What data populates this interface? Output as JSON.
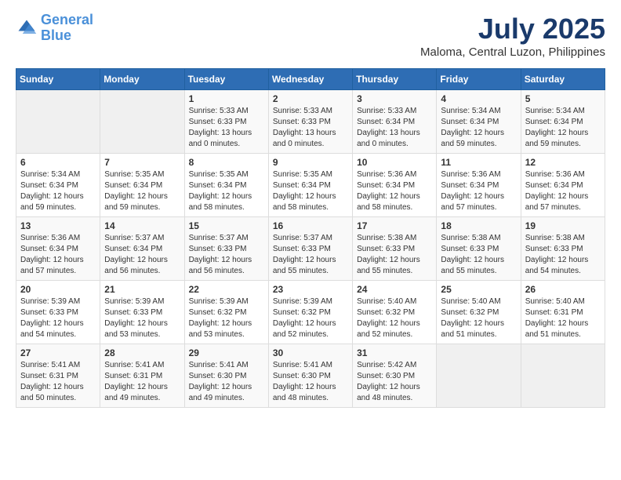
{
  "logo": {
    "line1": "General",
    "line2": "Blue"
  },
  "title": "July 2025",
  "location": "Maloma, Central Luzon, Philippines",
  "weekdays": [
    "Sunday",
    "Monday",
    "Tuesday",
    "Wednesday",
    "Thursday",
    "Friday",
    "Saturday"
  ],
  "weeks": [
    [
      {
        "day": "",
        "sunrise": "",
        "sunset": "",
        "daylight": ""
      },
      {
        "day": "",
        "sunrise": "",
        "sunset": "",
        "daylight": ""
      },
      {
        "day": "1",
        "sunrise": "Sunrise: 5:33 AM",
        "sunset": "Sunset: 6:33 PM",
        "daylight": "Daylight: 13 hours and 0 minutes."
      },
      {
        "day": "2",
        "sunrise": "Sunrise: 5:33 AM",
        "sunset": "Sunset: 6:33 PM",
        "daylight": "Daylight: 13 hours and 0 minutes."
      },
      {
        "day": "3",
        "sunrise": "Sunrise: 5:33 AM",
        "sunset": "Sunset: 6:34 PM",
        "daylight": "Daylight: 13 hours and 0 minutes."
      },
      {
        "day": "4",
        "sunrise": "Sunrise: 5:34 AM",
        "sunset": "Sunset: 6:34 PM",
        "daylight": "Daylight: 12 hours and 59 minutes."
      },
      {
        "day": "5",
        "sunrise": "Sunrise: 5:34 AM",
        "sunset": "Sunset: 6:34 PM",
        "daylight": "Daylight: 12 hours and 59 minutes."
      }
    ],
    [
      {
        "day": "6",
        "sunrise": "Sunrise: 5:34 AM",
        "sunset": "Sunset: 6:34 PM",
        "daylight": "Daylight: 12 hours and 59 minutes."
      },
      {
        "day": "7",
        "sunrise": "Sunrise: 5:35 AM",
        "sunset": "Sunset: 6:34 PM",
        "daylight": "Daylight: 12 hours and 59 minutes."
      },
      {
        "day": "8",
        "sunrise": "Sunrise: 5:35 AM",
        "sunset": "Sunset: 6:34 PM",
        "daylight": "Daylight: 12 hours and 58 minutes."
      },
      {
        "day": "9",
        "sunrise": "Sunrise: 5:35 AM",
        "sunset": "Sunset: 6:34 PM",
        "daylight": "Daylight: 12 hours and 58 minutes."
      },
      {
        "day": "10",
        "sunrise": "Sunrise: 5:36 AM",
        "sunset": "Sunset: 6:34 PM",
        "daylight": "Daylight: 12 hours and 58 minutes."
      },
      {
        "day": "11",
        "sunrise": "Sunrise: 5:36 AM",
        "sunset": "Sunset: 6:34 PM",
        "daylight": "Daylight: 12 hours and 57 minutes."
      },
      {
        "day": "12",
        "sunrise": "Sunrise: 5:36 AM",
        "sunset": "Sunset: 6:34 PM",
        "daylight": "Daylight: 12 hours and 57 minutes."
      }
    ],
    [
      {
        "day": "13",
        "sunrise": "Sunrise: 5:36 AM",
        "sunset": "Sunset: 6:34 PM",
        "daylight": "Daylight: 12 hours and 57 minutes."
      },
      {
        "day": "14",
        "sunrise": "Sunrise: 5:37 AM",
        "sunset": "Sunset: 6:34 PM",
        "daylight": "Daylight: 12 hours and 56 minutes."
      },
      {
        "day": "15",
        "sunrise": "Sunrise: 5:37 AM",
        "sunset": "Sunset: 6:33 PM",
        "daylight": "Daylight: 12 hours and 56 minutes."
      },
      {
        "day": "16",
        "sunrise": "Sunrise: 5:37 AM",
        "sunset": "Sunset: 6:33 PM",
        "daylight": "Daylight: 12 hours and 55 minutes."
      },
      {
        "day": "17",
        "sunrise": "Sunrise: 5:38 AM",
        "sunset": "Sunset: 6:33 PM",
        "daylight": "Daylight: 12 hours and 55 minutes."
      },
      {
        "day": "18",
        "sunrise": "Sunrise: 5:38 AM",
        "sunset": "Sunset: 6:33 PM",
        "daylight": "Daylight: 12 hours and 55 minutes."
      },
      {
        "day": "19",
        "sunrise": "Sunrise: 5:38 AM",
        "sunset": "Sunset: 6:33 PM",
        "daylight": "Daylight: 12 hours and 54 minutes."
      }
    ],
    [
      {
        "day": "20",
        "sunrise": "Sunrise: 5:39 AM",
        "sunset": "Sunset: 6:33 PM",
        "daylight": "Daylight: 12 hours and 54 minutes."
      },
      {
        "day": "21",
        "sunrise": "Sunrise: 5:39 AM",
        "sunset": "Sunset: 6:33 PM",
        "daylight": "Daylight: 12 hours and 53 minutes."
      },
      {
        "day": "22",
        "sunrise": "Sunrise: 5:39 AM",
        "sunset": "Sunset: 6:32 PM",
        "daylight": "Daylight: 12 hours and 53 minutes."
      },
      {
        "day": "23",
        "sunrise": "Sunrise: 5:39 AM",
        "sunset": "Sunset: 6:32 PM",
        "daylight": "Daylight: 12 hours and 52 minutes."
      },
      {
        "day": "24",
        "sunrise": "Sunrise: 5:40 AM",
        "sunset": "Sunset: 6:32 PM",
        "daylight": "Daylight: 12 hours and 52 minutes."
      },
      {
        "day": "25",
        "sunrise": "Sunrise: 5:40 AM",
        "sunset": "Sunset: 6:32 PM",
        "daylight": "Daylight: 12 hours and 51 minutes."
      },
      {
        "day": "26",
        "sunrise": "Sunrise: 5:40 AM",
        "sunset": "Sunset: 6:31 PM",
        "daylight": "Daylight: 12 hours and 51 minutes."
      }
    ],
    [
      {
        "day": "27",
        "sunrise": "Sunrise: 5:41 AM",
        "sunset": "Sunset: 6:31 PM",
        "daylight": "Daylight: 12 hours and 50 minutes."
      },
      {
        "day": "28",
        "sunrise": "Sunrise: 5:41 AM",
        "sunset": "Sunset: 6:31 PM",
        "daylight": "Daylight: 12 hours and 49 minutes."
      },
      {
        "day": "29",
        "sunrise": "Sunrise: 5:41 AM",
        "sunset": "Sunset: 6:30 PM",
        "daylight": "Daylight: 12 hours and 49 minutes."
      },
      {
        "day": "30",
        "sunrise": "Sunrise: 5:41 AM",
        "sunset": "Sunset: 6:30 PM",
        "daylight": "Daylight: 12 hours and 48 minutes."
      },
      {
        "day": "31",
        "sunrise": "Sunrise: 5:42 AM",
        "sunset": "Sunset: 6:30 PM",
        "daylight": "Daylight: 12 hours and 48 minutes."
      },
      {
        "day": "",
        "sunrise": "",
        "sunset": "",
        "daylight": ""
      },
      {
        "day": "",
        "sunrise": "",
        "sunset": "",
        "daylight": ""
      }
    ]
  ]
}
